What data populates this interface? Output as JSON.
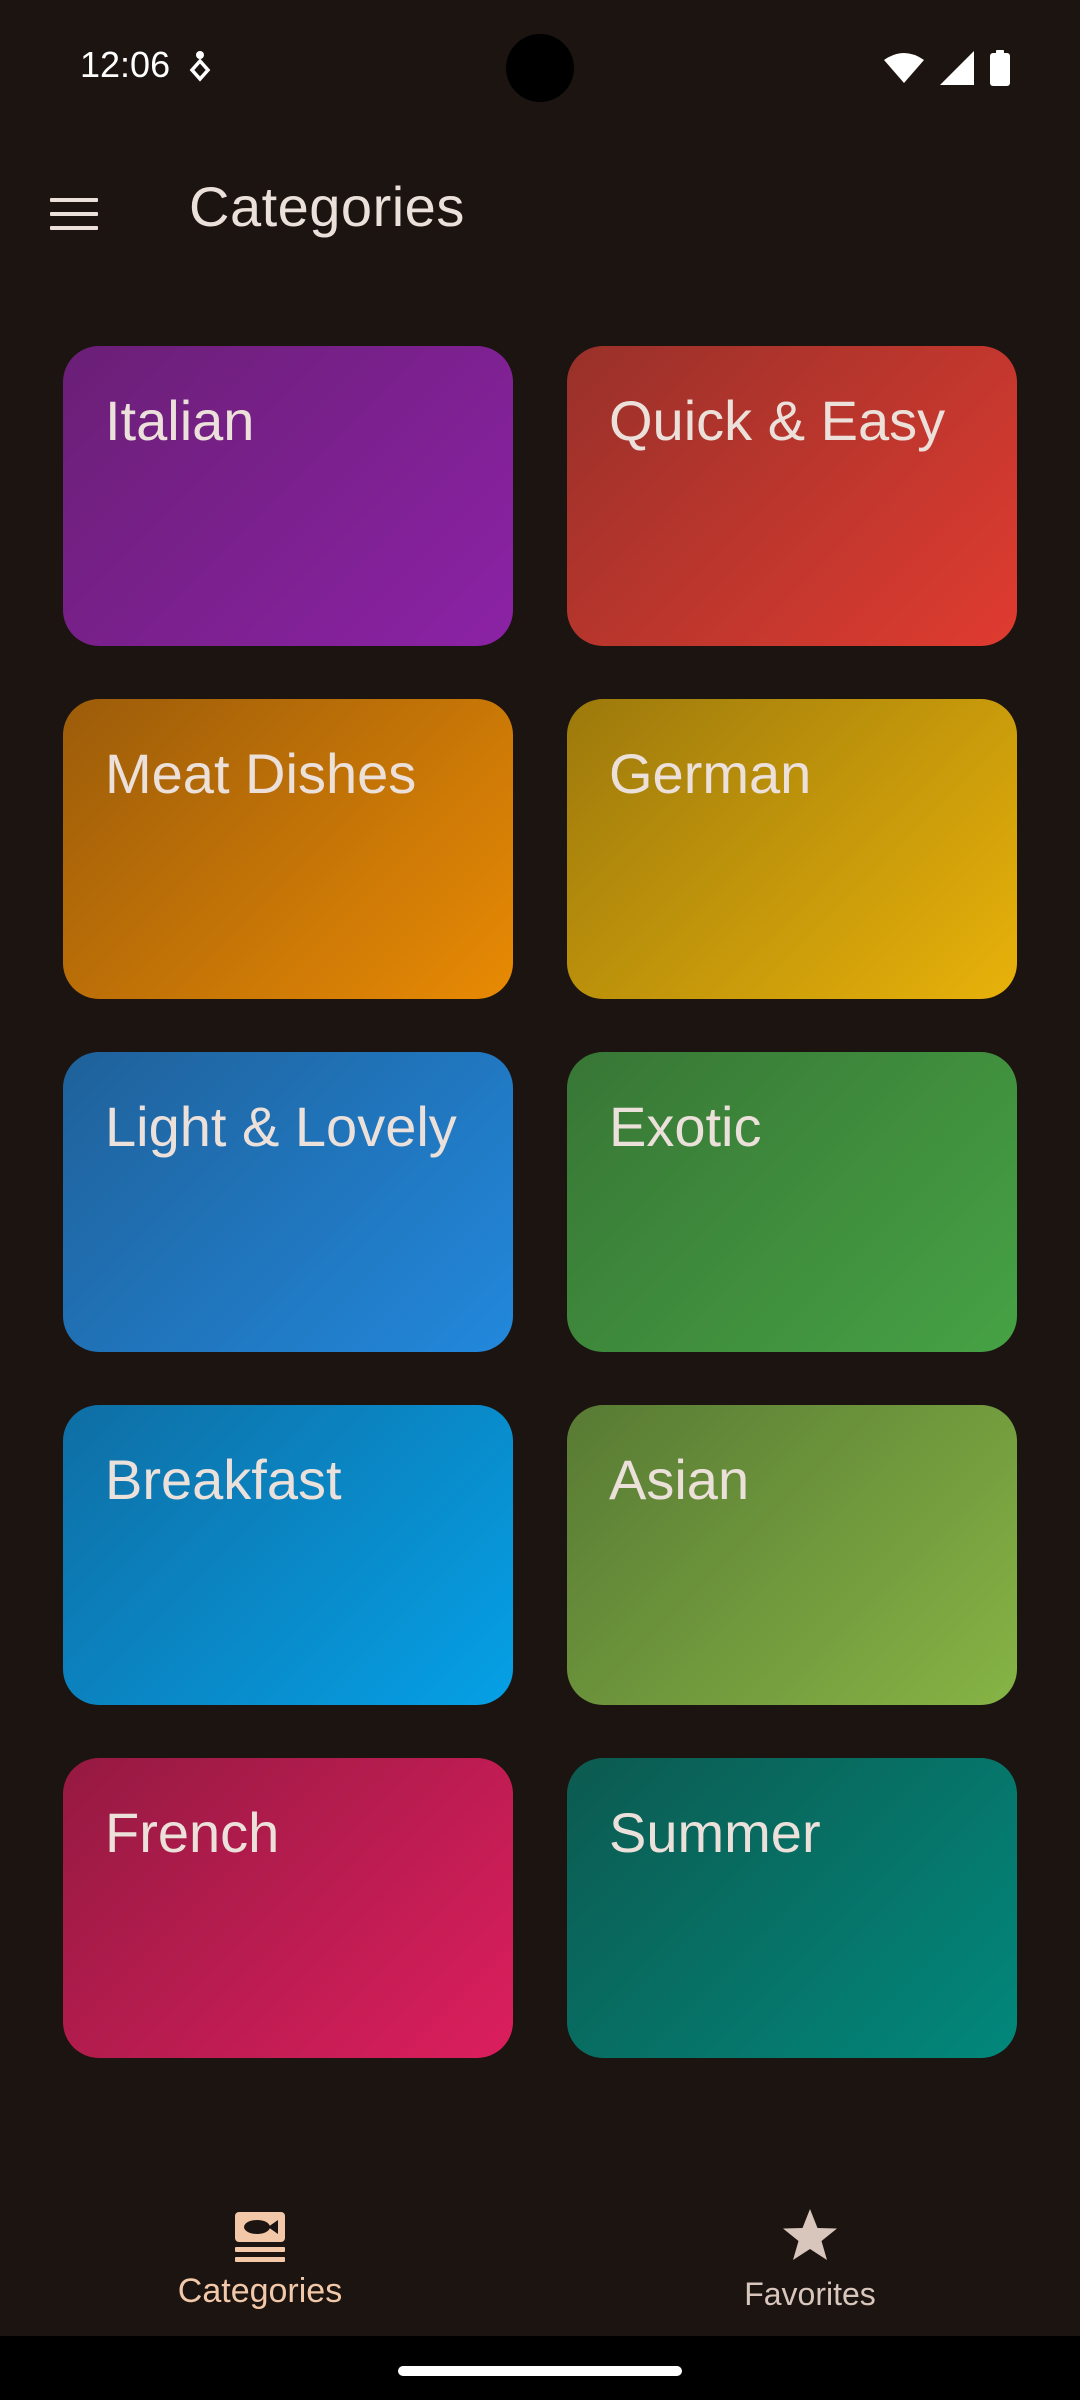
{
  "status_bar": {
    "time": "12:06",
    "icons": [
      "wifi-icon",
      "signal-icon",
      "battery-icon"
    ]
  },
  "app_bar": {
    "title": "Categories",
    "menu_icon": "menu-icon"
  },
  "categories": [
    {
      "label": "Italian",
      "colors": [
        "#6a1f76",
        "#8c22a6"
      ]
    },
    {
      "label": "Quick & Easy",
      "colors": [
        "#98312a",
        "#e03b30"
      ]
    },
    {
      "label": "Meat Dishes",
      "colors": [
        "#9c5c0a",
        "#e88a04"
      ]
    },
    {
      "label": "German",
      "colors": [
        "#9c790c",
        "#e8b20a"
      ]
    },
    {
      "label": "Light & Lovely",
      "colors": [
        "#1f619a",
        "#2288dc"
      ]
    },
    {
      "label": "Exotic",
      "colors": [
        "#387636",
        "#46a244"
      ]
    },
    {
      "label": "Breakfast",
      "colors": [
        "#0f6ea4",
        "#05a0e6"
      ]
    },
    {
      "label": "Asian",
      "colors": [
        "#587a34",
        "#86b445"
      ]
    },
    {
      "label": "French",
      "colors": [
        "#951a42",
        "#dc1e5e"
      ]
    },
    {
      "label": "Summer",
      "colors": [
        "#0c5a50",
        "#02887c"
      ]
    }
  ],
  "bottom_nav": {
    "items": [
      {
        "label": "Categories",
        "icon": "set-meal-icon",
        "selected": true
      },
      {
        "label": "Favorites",
        "icon": "star-icon",
        "selected": false
      }
    ]
  },
  "theme": {
    "background": "#1b1410",
    "on_surface": "#ece0da",
    "selected_nav": "#f2c8a8"
  }
}
